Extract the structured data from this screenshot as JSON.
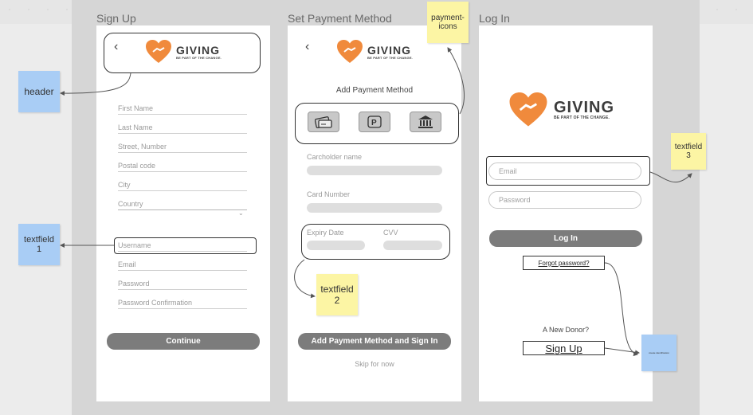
{
  "frames": {
    "signup": {
      "title": "Sign Up",
      "fields": [
        "First Name",
        "Last Name",
        "Street, Number",
        "Postal code",
        "City",
        "Country",
        "Username",
        "Email",
        "Password",
        "Password Confirmation"
      ],
      "continue_label": "Continue"
    },
    "payment": {
      "title": "Set Payment Method",
      "heading": "Add Payment Method",
      "icons": [
        "credit-card-icon",
        "paypal-icon",
        "bank-icon"
      ],
      "cardholder_label": "Carcholder name",
      "card_number_label": "Card Number",
      "expiry_label": "Expiry Date",
      "cvv_label": "CVV",
      "submit_label": "Add Payment Method and Sign In",
      "skip_label": "Skip for now"
    },
    "login": {
      "title": "Log In",
      "email_placeholder": "Email",
      "password_placeholder": "Password",
      "login_label": "Log In",
      "forgot_label": "Forgot password?",
      "new_donor_label": "A New Donor?",
      "signup_label": "Sign Up"
    }
  },
  "brand": {
    "name": "GIVING",
    "tagline": "BE PART OF THE CHANGE.",
    "accent": "#f08a3c"
  },
  "notes": {
    "header": "header",
    "textfield1": [
      "textfield",
      "1"
    ],
    "textfield2": [
      "textfield",
      "2"
    ],
    "textfield3": [
      "textfield",
      "3"
    ],
    "payment_icons": [
      "payment-",
      "icons"
    ],
    "small_blue": "create identification"
  }
}
